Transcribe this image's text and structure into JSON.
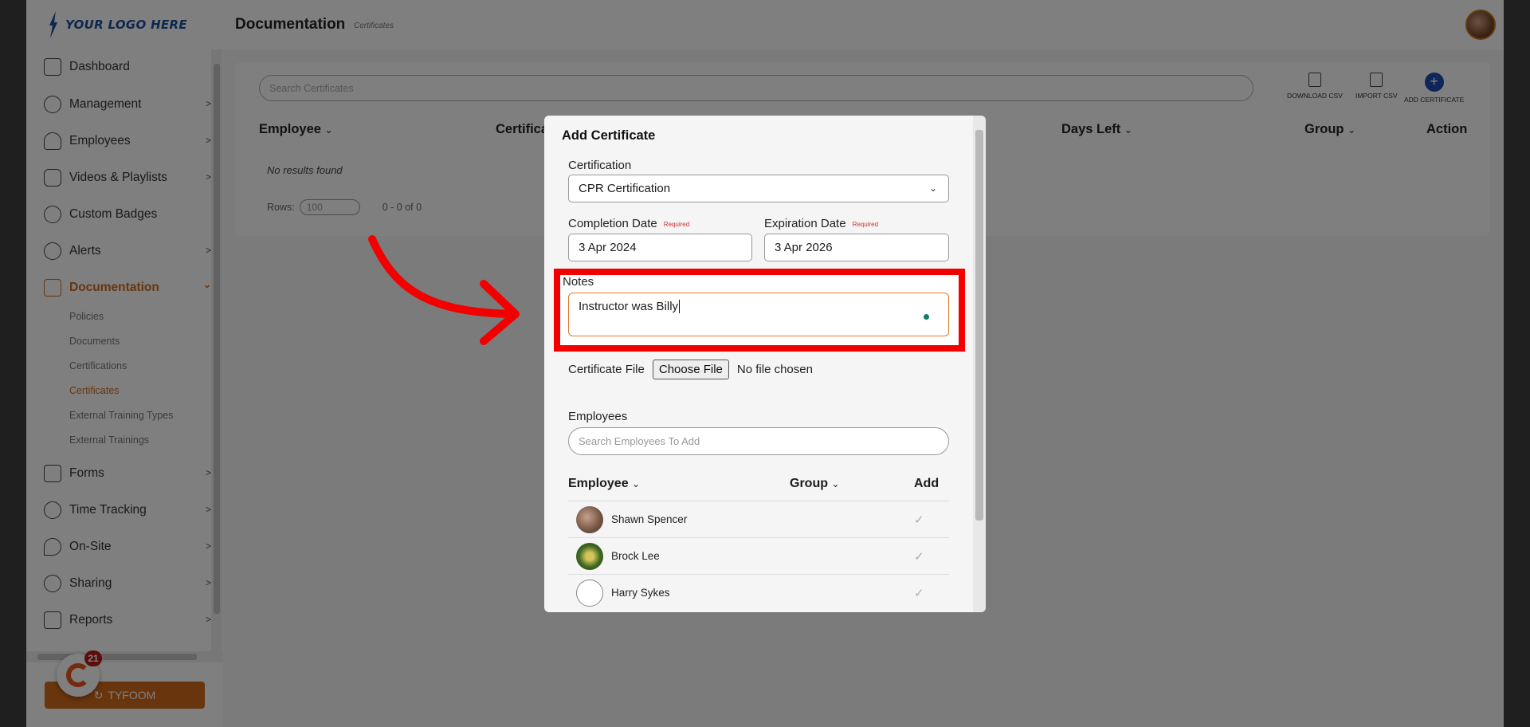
{
  "header": {
    "logo_text": "YOUR LOGO HERE",
    "title": "Documentation",
    "subtitle": "Certificates"
  },
  "sidebar": {
    "items": [
      {
        "label": "Dashboard",
        "icon": "dashboard-icon"
      },
      {
        "label": "Management",
        "icon": "management-icon",
        "chevron": ">"
      },
      {
        "label": "Employees",
        "icon": "employees-icon",
        "chevron": ">"
      },
      {
        "label": "Videos & Playlists",
        "icon": "video-icon",
        "chevron": ">"
      },
      {
        "label": "Custom Badges",
        "icon": "badge-icon"
      },
      {
        "label": "Alerts",
        "icon": "alerts-icon",
        "chevron": ">"
      },
      {
        "label": "Documentation",
        "icon": "documentation-icon",
        "chevron": "⌄"
      },
      {
        "label": "Forms",
        "icon": "forms-icon",
        "chevron": ">"
      },
      {
        "label": "Time Tracking",
        "icon": "timer-icon",
        "chevron": ">"
      },
      {
        "label": "On-Site",
        "icon": "location-icon",
        "chevron": ">"
      },
      {
        "label": "Sharing",
        "icon": "sharing-icon",
        "chevron": ">"
      },
      {
        "label": "Reports",
        "icon": "reports-icon",
        "chevron": ">"
      }
    ],
    "sub_items": [
      "Policies",
      "Documents",
      "Certifications",
      "Certificates",
      "External Training Types",
      "External Trainings"
    ],
    "brand_button": "TYFOOM",
    "chat_badge": "21"
  },
  "main": {
    "search_placeholder": "Search Certificates",
    "toolbar": {
      "download_csv": "DOWNLOAD CSV",
      "import_csv": "IMPORT CSV",
      "add_certificate": "ADD CERTIFICATE",
      "plus": "+"
    },
    "columns": {
      "employee": "Employee",
      "certification": "Certifica",
      "days_left": "Days Left",
      "group": "Group",
      "action": "Action",
      "sort_glyph": "⌄"
    },
    "no_results": "No results found",
    "rows_label": "Rows:",
    "rows_value": "100",
    "rows_count": "0 - 0 of 0"
  },
  "modal": {
    "title": "Add Certificate",
    "certification_label": "Certification",
    "certification_value": "CPR Certification",
    "completion_label": "Completion Date",
    "completion_value": "3 Apr 2024",
    "expiration_label": "Expiration Date",
    "expiration_value": "3 Apr 2026",
    "required_text": "Required",
    "notes_label": "Notes",
    "notes_value": "Instructor was Billy",
    "file_label": "Certificate File",
    "file_button": "Choose File",
    "file_status": "No file chosen",
    "employees_label": "Employees",
    "employees_placeholder": "Search Employees To Add",
    "table_headers": {
      "employee": "Employee",
      "group": "Group",
      "add": "Add"
    },
    "employees": [
      {
        "name": "Shawn Spencer"
      },
      {
        "name": "Brock Lee"
      },
      {
        "name": "Harry Sykes"
      }
    ]
  },
  "colors": {
    "accent": "#d06a1a",
    "highlight_box": "#f20000",
    "primary_blue": "#1c4fb0"
  }
}
